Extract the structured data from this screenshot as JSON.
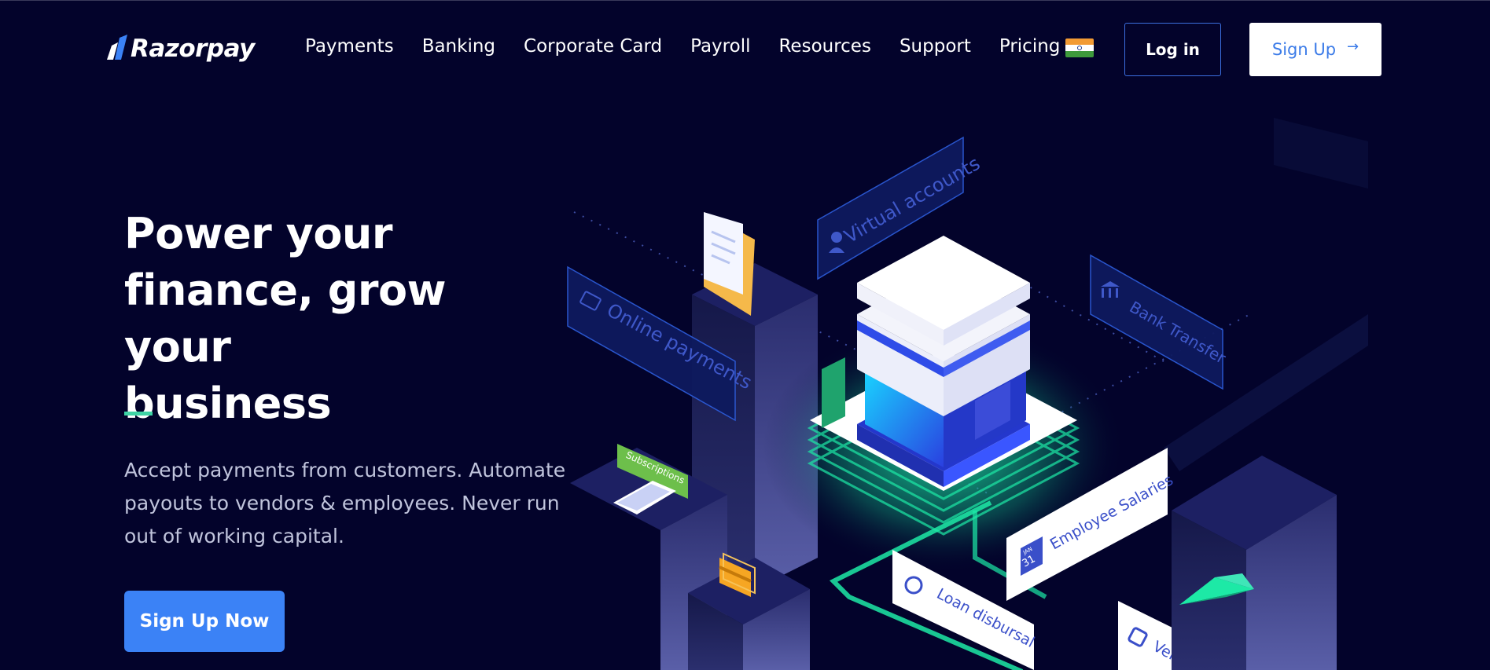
{
  "brand": {
    "name": "Razorpay"
  },
  "nav": {
    "items": [
      {
        "label": "Payments"
      },
      {
        "label": "Banking"
      },
      {
        "label": "Corporate Card"
      },
      {
        "label": "Payroll"
      },
      {
        "label": "Resources"
      },
      {
        "label": "Support"
      },
      {
        "label": "Pricing"
      }
    ],
    "country_flag": "india-flag-icon"
  },
  "header": {
    "login_label": "Log in",
    "signup_label": "Sign Up"
  },
  "hero": {
    "title_line1": "Power your",
    "title_line2": "finance, grow your",
    "title_line3": "business",
    "subtitle": "Accept payments from customers. Automate payouts to vendors & employees. Never run out of working capital.",
    "cta_label": "Sign Up Now"
  },
  "illustration": {
    "labels": {
      "virtual_accounts": "Virtual accounts",
      "online_payments": "Online payments",
      "bank_transfer": "Bank Transfer",
      "subscriptions": "Subscriptions",
      "employee_salaries": "Employee Salaries",
      "loan_disbursal": "Loan disbursal",
      "vendor": "Vend",
      "calendar_month": "JAN",
      "calendar_day": "31"
    }
  },
  "colors": {
    "background": "#03032b",
    "accent_blue": "#3b82f6",
    "accent_green": "#3fd4a5",
    "nav_text": "#ffffff"
  }
}
